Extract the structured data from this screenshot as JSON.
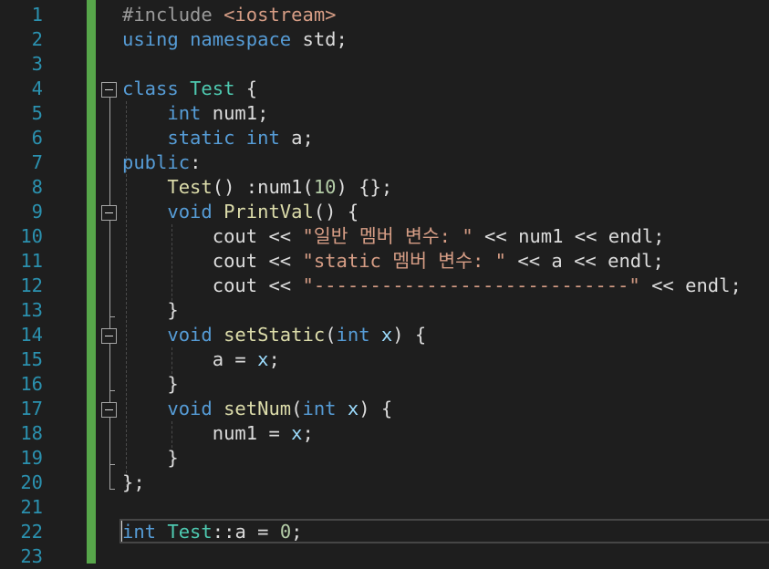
{
  "colors": {
    "background": "#1e1e1e",
    "line_number": "#2b91af",
    "change_bar": "#57a64a",
    "keyword": "#569cd6",
    "type": "#4ec9b0",
    "function": "#dcdcaa",
    "string": "#d69d85",
    "number": "#b5cea8",
    "preprocessor": "#9b9b9b",
    "parameter": "#9cdcfe",
    "plain": "#dcdcdc",
    "member": "#dadada"
  },
  "editor": {
    "line_numbers": [
      "1",
      "2",
      "3",
      "4",
      "5",
      "6",
      "7",
      "8",
      "9",
      "10",
      "11",
      "12",
      "13",
      "14",
      "15",
      "16",
      "17",
      "18",
      "19",
      "20",
      "21",
      "22",
      "23"
    ],
    "lines": [
      [
        {
          "t": "#include ",
          "c": "preprocessor"
        },
        {
          "t": "<iostream>",
          "c": "string"
        }
      ],
      [
        {
          "t": "using ",
          "c": "keyword"
        },
        {
          "t": "namespace ",
          "c": "keyword"
        },
        {
          "t": "std;",
          "c": "plain"
        }
      ],
      [],
      [
        {
          "t": "class ",
          "c": "keyword"
        },
        {
          "t": "Test",
          "c": "type"
        },
        {
          "t": " {",
          "c": "plain"
        }
      ],
      [
        {
          "t": "    ",
          "c": "plain"
        },
        {
          "t": "int ",
          "c": "keyword"
        },
        {
          "t": "num1;",
          "c": "plain"
        }
      ],
      [
        {
          "t": "    ",
          "c": "plain"
        },
        {
          "t": "static ",
          "c": "keyword"
        },
        {
          "t": "int ",
          "c": "keyword"
        },
        {
          "t": "a;",
          "c": "plain"
        }
      ],
      [
        {
          "t": "public",
          "c": "keyword"
        },
        {
          "t": ":",
          "c": "plain"
        }
      ],
      [
        {
          "t": "    ",
          "c": "plain"
        },
        {
          "t": "Test",
          "c": "function"
        },
        {
          "t": "() :",
          "c": "plain"
        },
        {
          "t": "num1",
          "c": "plain"
        },
        {
          "t": "(",
          "c": "plain"
        },
        {
          "t": "10",
          "c": "number"
        },
        {
          "t": ") {};",
          "c": "plain"
        }
      ],
      [
        {
          "t": "    ",
          "c": "plain"
        },
        {
          "t": "void ",
          "c": "keyword"
        },
        {
          "t": "PrintVal",
          "c": "function"
        },
        {
          "t": "() {",
          "c": "plain"
        }
      ],
      [
        {
          "t": "        cout << ",
          "c": "plain"
        },
        {
          "t": "\"일반 멤버 변수: \"",
          "c": "string"
        },
        {
          "t": " << num1 << endl;",
          "c": "plain"
        }
      ],
      [
        {
          "t": "        cout << ",
          "c": "plain"
        },
        {
          "t": "\"static 멤버 변수: \"",
          "c": "string"
        },
        {
          "t": " << a << endl;",
          "c": "plain"
        }
      ],
      [
        {
          "t": "        cout << ",
          "c": "plain"
        },
        {
          "t": "\"----------------------------\"",
          "c": "string"
        },
        {
          "t": " << endl;",
          "c": "plain"
        }
      ],
      [
        {
          "t": "    }",
          "c": "plain"
        }
      ],
      [
        {
          "t": "    ",
          "c": "plain"
        },
        {
          "t": "void ",
          "c": "keyword"
        },
        {
          "t": "setStatic",
          "c": "function"
        },
        {
          "t": "(",
          "c": "plain"
        },
        {
          "t": "int ",
          "c": "keyword"
        },
        {
          "t": "x",
          "c": "parameter"
        },
        {
          "t": ") {",
          "c": "plain"
        }
      ],
      [
        {
          "t": "        a = ",
          "c": "plain"
        },
        {
          "t": "x",
          "c": "parameter"
        },
        {
          "t": ";",
          "c": "plain"
        }
      ],
      [
        {
          "t": "    }",
          "c": "plain"
        }
      ],
      [
        {
          "t": "    ",
          "c": "plain"
        },
        {
          "t": "void ",
          "c": "keyword"
        },
        {
          "t": "setNum",
          "c": "function"
        },
        {
          "t": "(",
          "c": "plain"
        },
        {
          "t": "int ",
          "c": "keyword"
        },
        {
          "t": "x",
          "c": "parameter"
        },
        {
          "t": ") {",
          "c": "plain"
        }
      ],
      [
        {
          "t": "        num1 = ",
          "c": "plain"
        },
        {
          "t": "x",
          "c": "parameter"
        },
        {
          "t": ";",
          "c": "plain"
        }
      ],
      [
        {
          "t": "    }",
          "c": "plain"
        }
      ],
      [
        {
          "t": "};",
          "c": "plain"
        }
      ],
      [],
      [
        {
          "t": "int ",
          "c": "keyword"
        },
        {
          "t": "Test",
          "c": "type"
        },
        {
          "t": "::",
          "c": "plain"
        },
        {
          "t": "a = ",
          "c": "plain"
        },
        {
          "t": "0",
          "c": "number"
        },
        {
          "t": ";",
          "c": "plain"
        }
      ],
      []
    ],
    "current_line": "22"
  }
}
